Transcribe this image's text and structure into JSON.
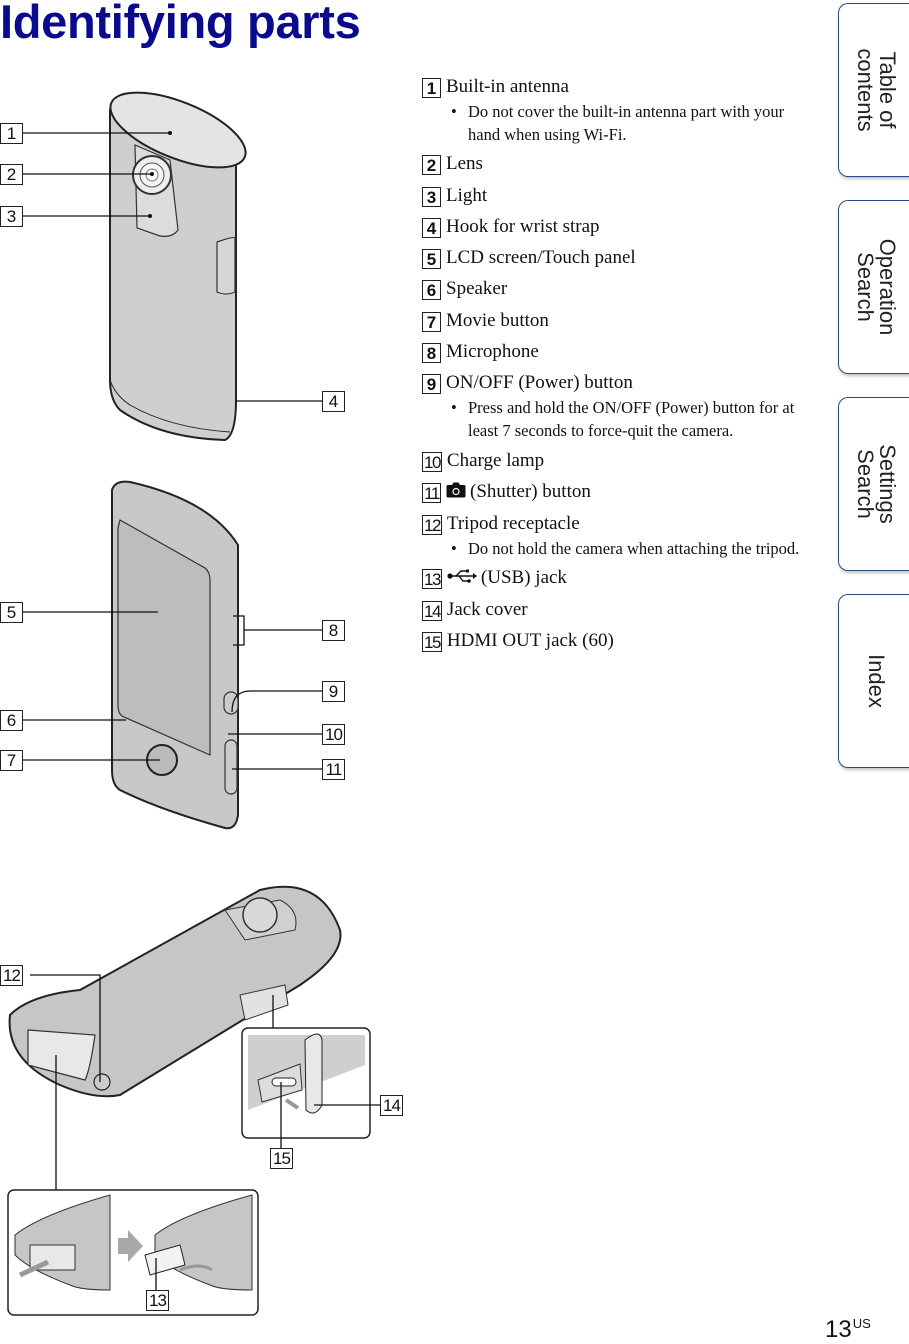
{
  "page": {
    "title": "Identifying parts",
    "number": "13",
    "number_suffix": "US"
  },
  "side_tabs": [
    {
      "label": "Table of\ncontents"
    },
    {
      "label": "Operation\nSearch"
    },
    {
      "label": "Settings\nSearch"
    },
    {
      "label": "Index"
    }
  ],
  "parts": [
    {
      "num": "1",
      "label": "Built-in antenna",
      "note": "Do not cover the built-in antenna part with your hand when using Wi-Fi."
    },
    {
      "num": "2",
      "label": "Lens"
    },
    {
      "num": "3",
      "label": "Light"
    },
    {
      "num": "4",
      "label": "Hook for wrist strap"
    },
    {
      "num": "5",
      "label": "LCD screen/Touch panel"
    },
    {
      "num": "6",
      "label": "Speaker"
    },
    {
      "num": "7",
      "label": "Movie button"
    },
    {
      "num": "8",
      "label": "Microphone"
    },
    {
      "num": "9",
      "label": "ON/OFF (Power) button",
      "note": "Press and hold the ON/OFF (Power) button for at least 7 seconds to force-quit the camera."
    },
    {
      "num": "10",
      "label": "Charge lamp"
    },
    {
      "num": "11",
      "icon": "camera-icon",
      "label": "(Shutter) button"
    },
    {
      "num": "12",
      "label": "Tripod receptacle",
      "note": "Do not hold the camera when attaching the tripod."
    },
    {
      "num": "13",
      "icon": "usb-icon",
      "label": "(USB) jack"
    },
    {
      "num": "14",
      "label": "Jack cover"
    },
    {
      "num": "15",
      "label": "HDMI OUT jack (60)"
    }
  ],
  "callouts": [
    "1",
    "2",
    "3",
    "4",
    "5",
    "6",
    "7",
    "8",
    "9",
    "10",
    "11",
    "12",
    "13",
    "14",
    "15"
  ],
  "colors": {
    "title": "#0a0a8c",
    "tab_border": "#2a4a8a",
    "device_body": "#cfcfcf"
  }
}
